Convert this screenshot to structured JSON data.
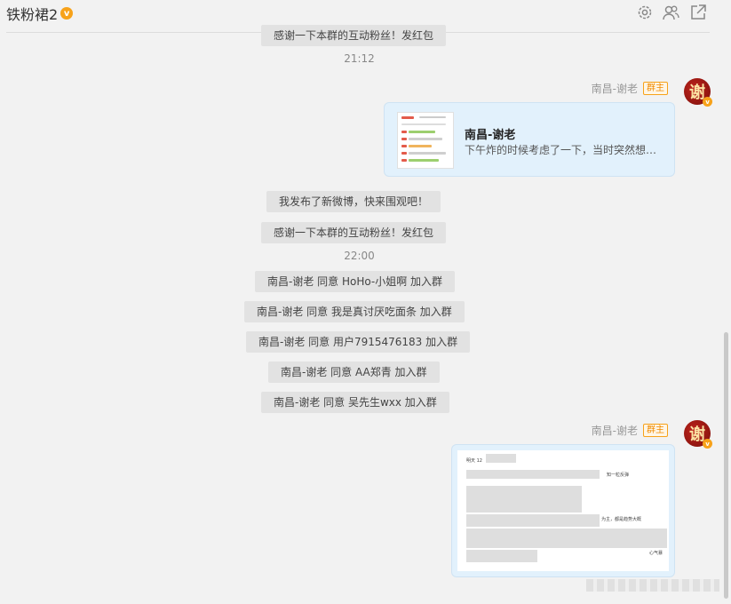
{
  "header": {
    "title": "铁粉裙2",
    "verified_badge": "v",
    "icons": [
      "gear-icon",
      "group-members-icon",
      "external-link-icon"
    ]
  },
  "messages": {
    "sys_top_partial": "感谢一下本群的互动粉丝！发红包",
    "time1": "21:12",
    "sender1": {
      "name": "南昌-谢老",
      "badge": "群主",
      "avatar_char": "谢"
    },
    "card": {
      "title": "南昌-谢老",
      "desc": "下午炸的时候考虑了一下，当时突然想…"
    },
    "sys1": "我发布了新微博，快来围观吧！",
    "sys2": "感谢一下本群的互动粉丝！发红包",
    "time2": "22:00",
    "join1": "南昌-谢老 同意 HoHo-小姐啊 加入群",
    "join2": "南昌-谢老 同意 我是真讨厌吃面条 加入群",
    "join3": "南昌-谢老 同意 用户7915476183 加入群",
    "join4": "南昌-谢老 同意 AA郑青 加入群",
    "join5": "南昌-谢老 同意 吴先生wxx 加入群",
    "sender2": {
      "name": "南昌-谢老",
      "badge": "群主",
      "avatar_char": "谢"
    },
    "image": {
      "line1": "明天 12",
      "line2": "知一粒反弹",
      "line3": "为主，都是趋势大概",
      "line4": "心气暴"
    }
  },
  "colors": {
    "accent_orange": "#f7a21a",
    "card_bg": "#e2f1fc",
    "sys_bg": "#e2e2e2"
  }
}
